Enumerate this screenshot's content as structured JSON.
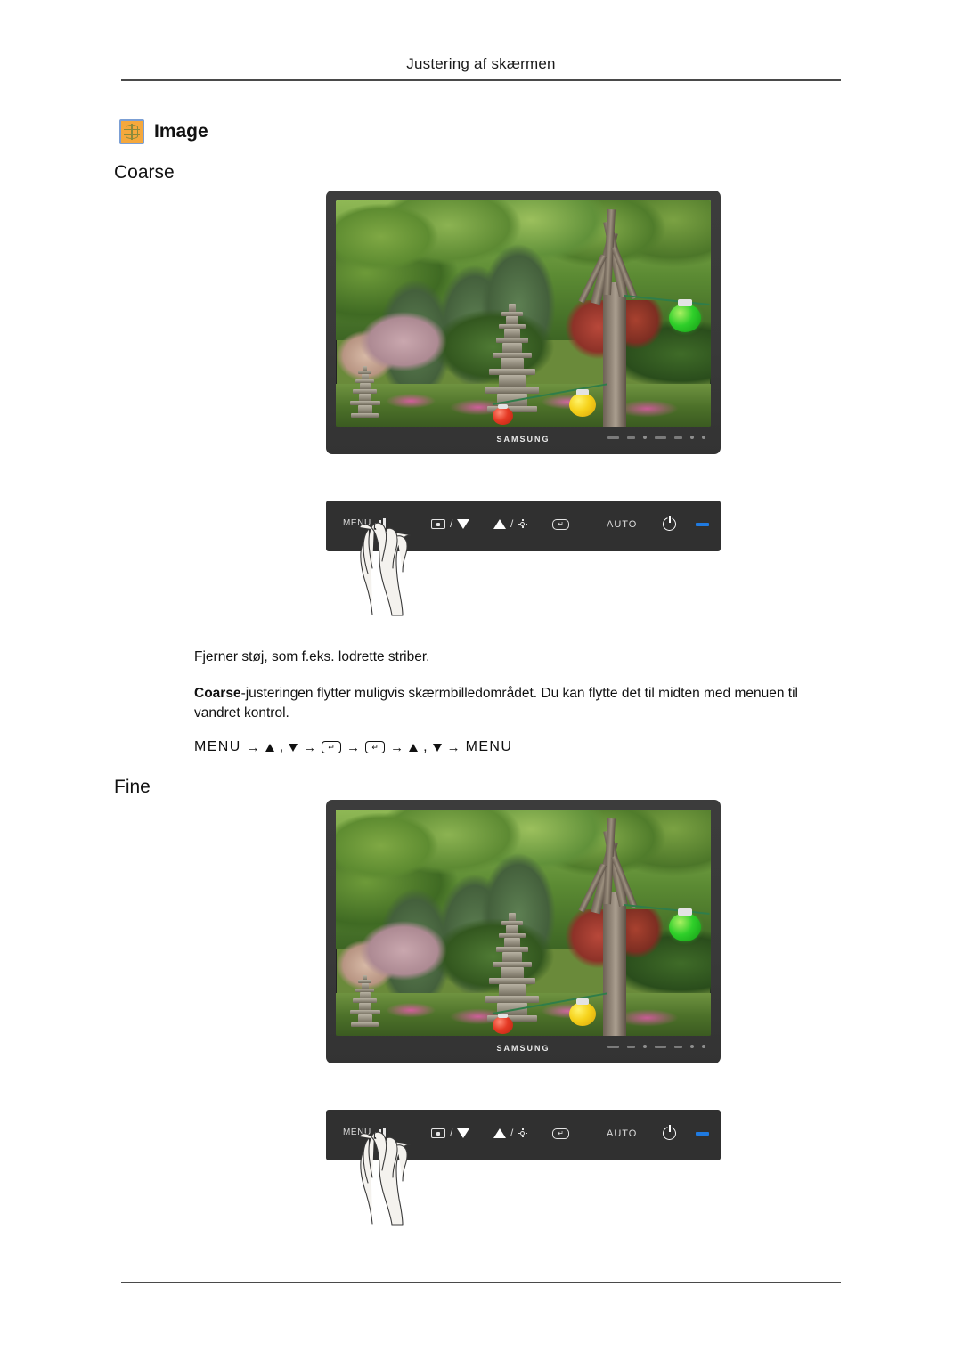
{
  "header": {
    "title": "Justering af skærmen"
  },
  "image_section": {
    "icon": "image-settings-icon",
    "label": "Image",
    "icon_bg_color": "#f5a83c",
    "icon_border_color": "#7b9fd4"
  },
  "sections": [
    {
      "id": "coarse",
      "title": "Coarse",
      "monitor": {
        "brand": "SAMSUNG",
        "screen_content": "Korean garden scene with stone pagoda, trees, and paper lanterns"
      },
      "control_panel": {
        "buttons": [
          {
            "name": "menu-button",
            "label": "MENU",
            "icon": "menu-bars-icon",
            "pressed": true
          },
          {
            "name": "source-down-button",
            "label": "",
            "icon": "source-icon",
            "secondary_icon": "triangle-down-icon",
            "separator": "/"
          },
          {
            "name": "up-brightness-button",
            "label": "",
            "icon": "triangle-up-icon",
            "secondary_icon": "brightness-sun-icon",
            "separator": "/"
          },
          {
            "name": "enter-button",
            "label": "",
            "icon": "enter-key-icon"
          },
          {
            "name": "auto-button",
            "label": "AUTO",
            "icon": ""
          },
          {
            "name": "power-button",
            "label": "",
            "icon": "power-icon"
          },
          {
            "name": "power-led",
            "label": "",
            "icon": "led-indicator",
            "color": "#1f7ae0"
          }
        ]
      }
    },
    {
      "id": "fine",
      "title": "Fine",
      "monitor": {
        "brand": "SAMSUNG",
        "screen_content": "Korean garden scene with stone pagoda, trees, and paper lanterns"
      },
      "control_panel": {
        "buttons": [
          {
            "name": "menu-button",
            "label": "MENU",
            "icon": "menu-bars-icon",
            "pressed": true
          },
          {
            "name": "source-down-button",
            "label": "",
            "icon": "source-icon",
            "secondary_icon": "triangle-down-icon",
            "separator": "/"
          },
          {
            "name": "up-brightness-button",
            "label": "",
            "icon": "triangle-up-icon",
            "secondary_icon": "brightness-sun-icon",
            "separator": "/"
          },
          {
            "name": "enter-button",
            "label": "",
            "icon": "enter-key-icon"
          },
          {
            "name": "auto-button",
            "label": "AUTO",
            "icon": ""
          },
          {
            "name": "power-button",
            "label": "",
            "icon": "power-icon"
          },
          {
            "name": "power-led",
            "label": "",
            "icon": "led-indicator",
            "color": "#1f7ae0"
          }
        ]
      }
    }
  ],
  "body": {
    "paragraph_1": "Fjerner støj, som f.eks. lodrette striber.",
    "paragraph_2_bold": "Coarse",
    "paragraph_2_rest": "-justeringen flytter muligvis skærmbilledområdet. Du kan flytte det til midten med menuen til vandret kontrol.",
    "nav_sequence": {
      "start": "MENU",
      "end": "MENU",
      "arrow": "→",
      "comma": ",",
      "enter_glyph": "↵"
    }
  },
  "control_labels": {
    "menu": "MENU",
    "auto": "AUTO",
    "slash": "/"
  }
}
